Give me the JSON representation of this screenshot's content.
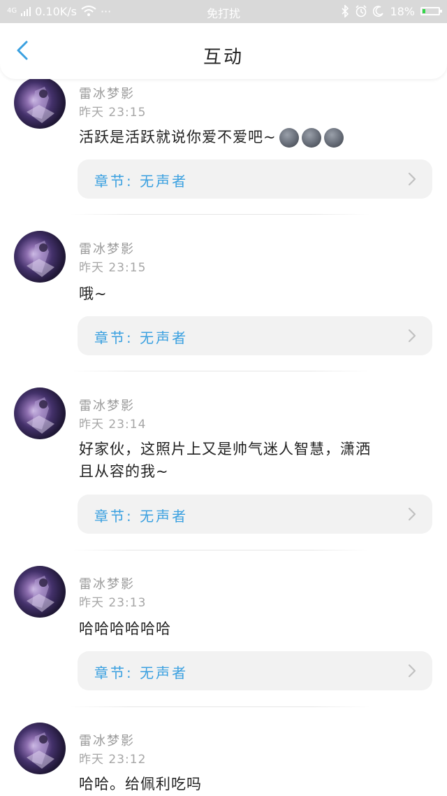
{
  "status_bar": {
    "network": "4G",
    "speed": "0.10K/s",
    "more": "···",
    "mode": "免打扰",
    "battery": "18%",
    "battery_level": 0.18
  },
  "nav": {
    "title": "互动"
  },
  "comments": [
    {
      "author": "雷冰梦影",
      "time": "昨天 23:15",
      "text": "活跃是活跃就说你爱不爱吧~",
      "emoji_count": 3,
      "emoji_name": "new-moon-face",
      "chapter": "章节:  无声者"
    },
    {
      "author": "雷冰梦影",
      "time": "昨天 23:15",
      "text": "哦~",
      "chapter": "章节:  无声者"
    },
    {
      "author": "雷冰梦影",
      "time": "昨天 23:14",
      "text_lines": [
        "好家伙，这照片上又是帅气迷人智慧，潇洒",
        "且从容的我~"
      ],
      "chapter": "章节:  无声者"
    },
    {
      "author": "雷冰梦影",
      "time": "昨天 23:13",
      "text": "哈哈哈哈哈哈",
      "chapter": "章节:  无声者"
    },
    {
      "author": "雷冰梦影",
      "time": "昨天 23:12",
      "text": "哈哈。给佩利吃吗"
    }
  ],
  "colors": {
    "accent": "#3aa0e0",
    "status_bar_bg": "#d9d9d9",
    "chapter_bg": "#f2f2f2"
  }
}
